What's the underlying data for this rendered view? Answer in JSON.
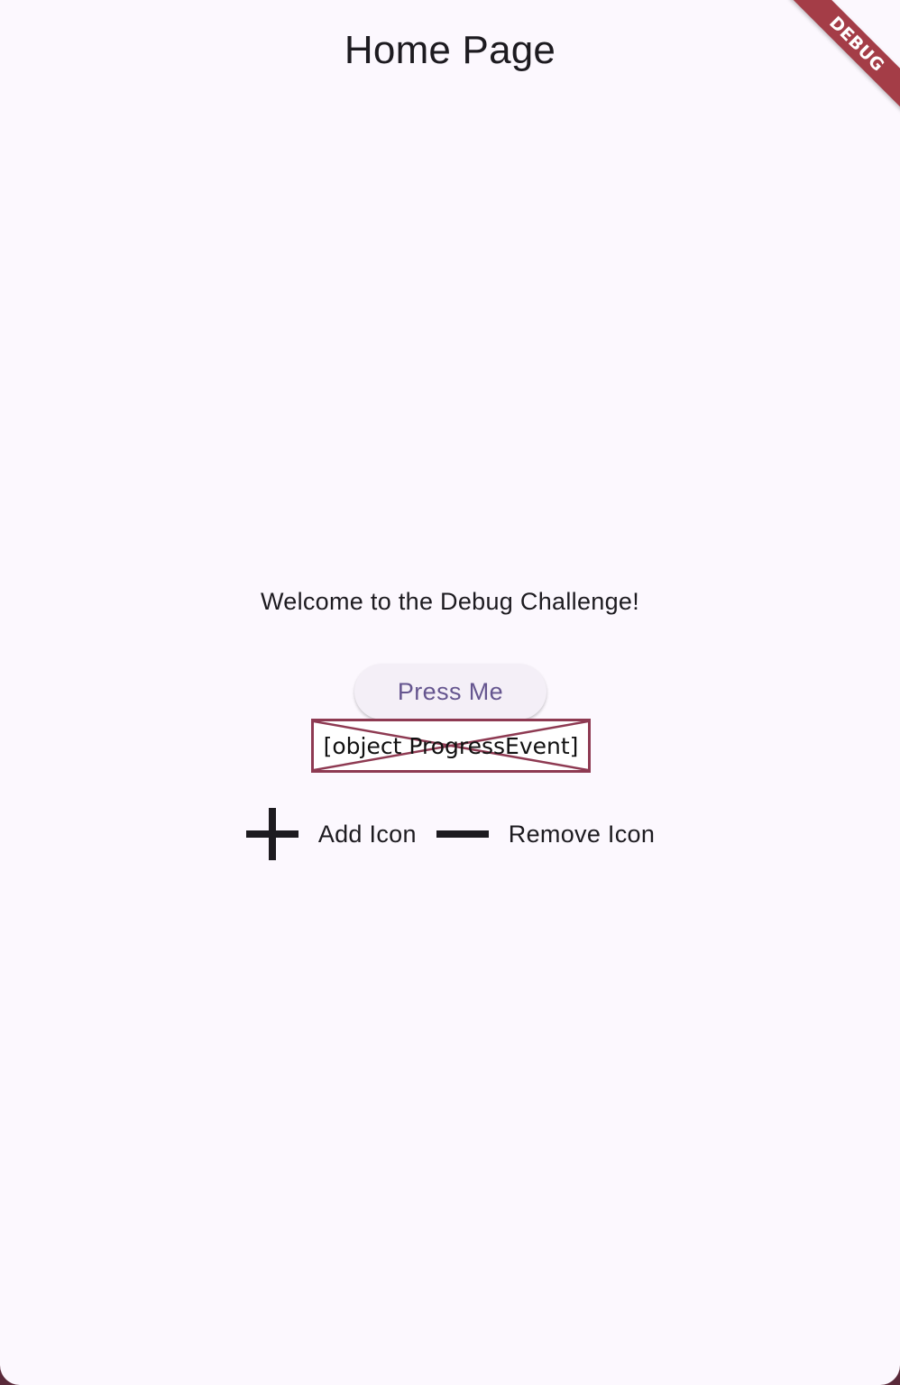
{
  "app_bar": {
    "title": "Home Page"
  },
  "debug_banner": {
    "label": "DEBUG"
  },
  "main": {
    "welcome_text": "Welcome to the Debug Challenge!",
    "press_button_label": "Press Me",
    "broken_image_text": "[object ProgressEvent]",
    "icons": [
      {
        "icon": "add-icon",
        "label": "Add Icon"
      },
      {
        "icon": "remove-icon",
        "label": "Remove Icon"
      }
    ]
  },
  "colors": {
    "background": "#fcf8fe",
    "text": "#1d1b20",
    "button_text": "#65558f",
    "button_background": "#f4eff7",
    "error_border": "#8e3a52",
    "debug_banner": "#a43d47"
  }
}
